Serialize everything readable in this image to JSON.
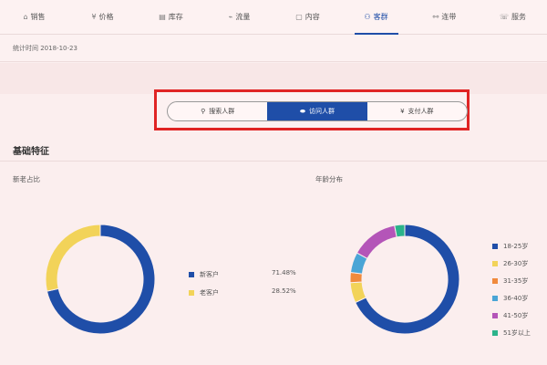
{
  "nav": {
    "items": [
      {
        "label": "销售",
        "icon": "sales-icon",
        "glyph": "⌂"
      },
      {
        "label": "价格",
        "icon": "price-icon",
        "glyph": "¥"
      },
      {
        "label": "库存",
        "icon": "inventory-icon",
        "glyph": "▤"
      },
      {
        "label": "流量",
        "icon": "traffic-icon",
        "glyph": "⌁"
      },
      {
        "label": "内容",
        "icon": "content-icon",
        "glyph": "▢"
      },
      {
        "label": "客群",
        "icon": "customer-group-icon",
        "glyph": "⚇"
      },
      {
        "label": "连带",
        "icon": "link-icon",
        "glyph": "⚯"
      },
      {
        "label": "服务",
        "icon": "service-icon",
        "glyph": "☏"
      }
    ],
    "active_index": 5
  },
  "stat_date": "统计时间 2018-10-23",
  "segments": {
    "search": {
      "label": "搜索人群",
      "icon": "search-icon",
      "glyph": "⚲"
    },
    "visit": {
      "label": "访问人群",
      "icon": "eye-icon",
      "glyph": "⬬"
    },
    "pay": {
      "label": "支付人群",
      "icon": "pay-icon",
      "glyph": "¥"
    }
  },
  "section_title": "基础特征",
  "chart_data": [
    {
      "type": "pie",
      "title": "新老占比",
      "labels": [
        "新客户",
        "老客户"
      ],
      "values": [
        71.48,
        28.52
      ],
      "value_labels": [
        "71.48%",
        "28.52%"
      ],
      "colors": [
        "#1f4ea8",
        "#f2d359"
      ],
      "legend": "right"
    },
    {
      "type": "pie",
      "title": "年龄分布",
      "labels": [
        "18-25岁",
        "26-30岁",
        "31-35岁",
        "36-40岁",
        "41-50岁",
        "51岁以上"
      ],
      "values": [
        68,
        6,
        3,
        6,
        14,
        3
      ],
      "colors": [
        "#1f4ea8",
        "#f2d359",
        "#f08a3c",
        "#4aa5d6",
        "#b455b8",
        "#2bb38a"
      ],
      "legend": "right"
    }
  ]
}
